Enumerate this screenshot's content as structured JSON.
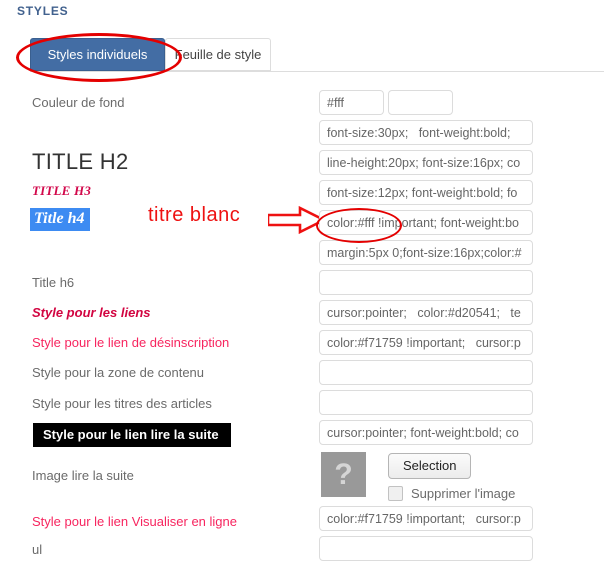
{
  "header": {
    "title": "STYLES"
  },
  "tabs": [
    {
      "label": "Styles individuels",
      "active": true
    },
    {
      "label": "Feuille de style",
      "active": false
    }
  ],
  "annotation": {
    "text": "titre blanc",
    "arrow_icon": "right-arrow-outline-icon",
    "ellipse_icon": "red-ellipse-highlight",
    "color": "#ee1111"
  },
  "rows": [
    {
      "label": "Couleur de fond",
      "label_style": "plain",
      "field_value": "#fff",
      "field2_value": ""
    },
    {
      "label": "",
      "label_style": "none",
      "field_value": "font-size:30px;   font-weight:bold;"
    },
    {
      "label": "TITLE H2",
      "label_style": "h2",
      "field_value": "line-height:20px; font-size:16px; co"
    },
    {
      "label": "TITLE H3",
      "label_style": "h3",
      "field_value": "font-size:12px; font-weight:bold; fo"
    },
    {
      "label": "Title h4",
      "label_style": "h4",
      "field_value": "color:#fff !important; font-weight:bo"
    },
    {
      "label": "",
      "label_style": "none",
      "field_value": "margin:5px 0;font-size:16px;color:#"
    },
    {
      "label": "Title h6",
      "label_style": "plain",
      "field_value": ""
    },
    {
      "label": "Style pour les liens",
      "label_style": "links",
      "field_value": "cursor:pointer;   color:#d20541;   te"
    },
    {
      "label": "Style pour le lien de désinscription",
      "label_style": "pink",
      "field_value": "color:#f71759 !important;   cursor:p"
    },
    {
      "label": "Style pour la zone de contenu",
      "label_style": "plain",
      "field_value": ""
    },
    {
      "label": "Style pour les titres des articles",
      "label_style": "plain",
      "field_value": ""
    },
    {
      "label": "Style pour le lien lire la suite",
      "label_style": "black",
      "field_value": "cursor:pointer; font-weight:bold; co"
    },
    {
      "label": "Image lire la suite",
      "label_style": "plain",
      "field_value": null
    },
    {
      "label": "Style pour le lien Visualiser en ligne",
      "label_style": "pink",
      "field_value": "color:#f71759 !important;   cursor:p"
    },
    {
      "label": "ul",
      "label_style": "plain",
      "field_value": ""
    }
  ],
  "image_block": {
    "placeholder_glyph": "?",
    "select_button_label": "Selection",
    "delete_checkbox_label": "Supprimer l'image",
    "delete_checked": false
  },
  "colors": {
    "tab_active_bg": "#436da4",
    "annotation_red": "#e40000",
    "h4_highlight": "#3d8bf2",
    "h3_text": "#d2084b",
    "pink_text": "#f7255f",
    "link_text": "#d20541"
  }
}
